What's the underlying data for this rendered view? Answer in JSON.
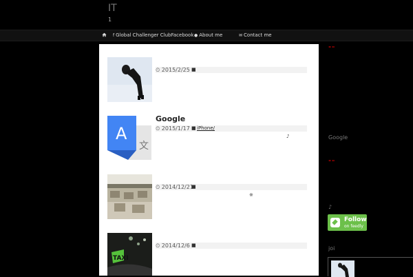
{
  "header": {
    "site_title": "IT",
    "site_subtitle": "1"
  },
  "nav": {
    "home_icon": "home-icon",
    "items": [
      {
        "icon": "facebook-icon",
        "label": "Global Challenger ClubFacebook"
      },
      {
        "icon": "user-icon",
        "label": "About me"
      },
      {
        "icon": "envelope-icon",
        "label": "Contact me"
      }
    ]
  },
  "posts": [
    {
      "title": "",
      "date": "2015/2/25",
      "tag": "",
      "thumb_icon": "bowing-man-thumb"
    },
    {
      "title": "Google",
      "date": "2015/1/17",
      "tag": "iPhone/",
      "thumb_icon": "google-translate-thumb",
      "extra": "♪"
    },
    {
      "title": "",
      "date": "2014/12/21",
      "tag": "",
      "thumb_icon": "office-thumb",
      "extra": "※"
    },
    {
      "title": "",
      "date": "2014/12/6",
      "tag": "",
      "thumb_icon": "taxi-thumb"
    }
  ],
  "sidebar": {
    "mark1": "\"\"",
    "google_text": "Google",
    "mark2": "\"\"",
    "note": "♪",
    "feedly": {
      "title": "Follow",
      "sub": "on feedly",
      "color": "#6cc04a"
    },
    "profile_text": "joi"
  },
  "colors": {
    "background": "#000000",
    "main": "#ffffff",
    "accent_red": "#cc0000"
  }
}
